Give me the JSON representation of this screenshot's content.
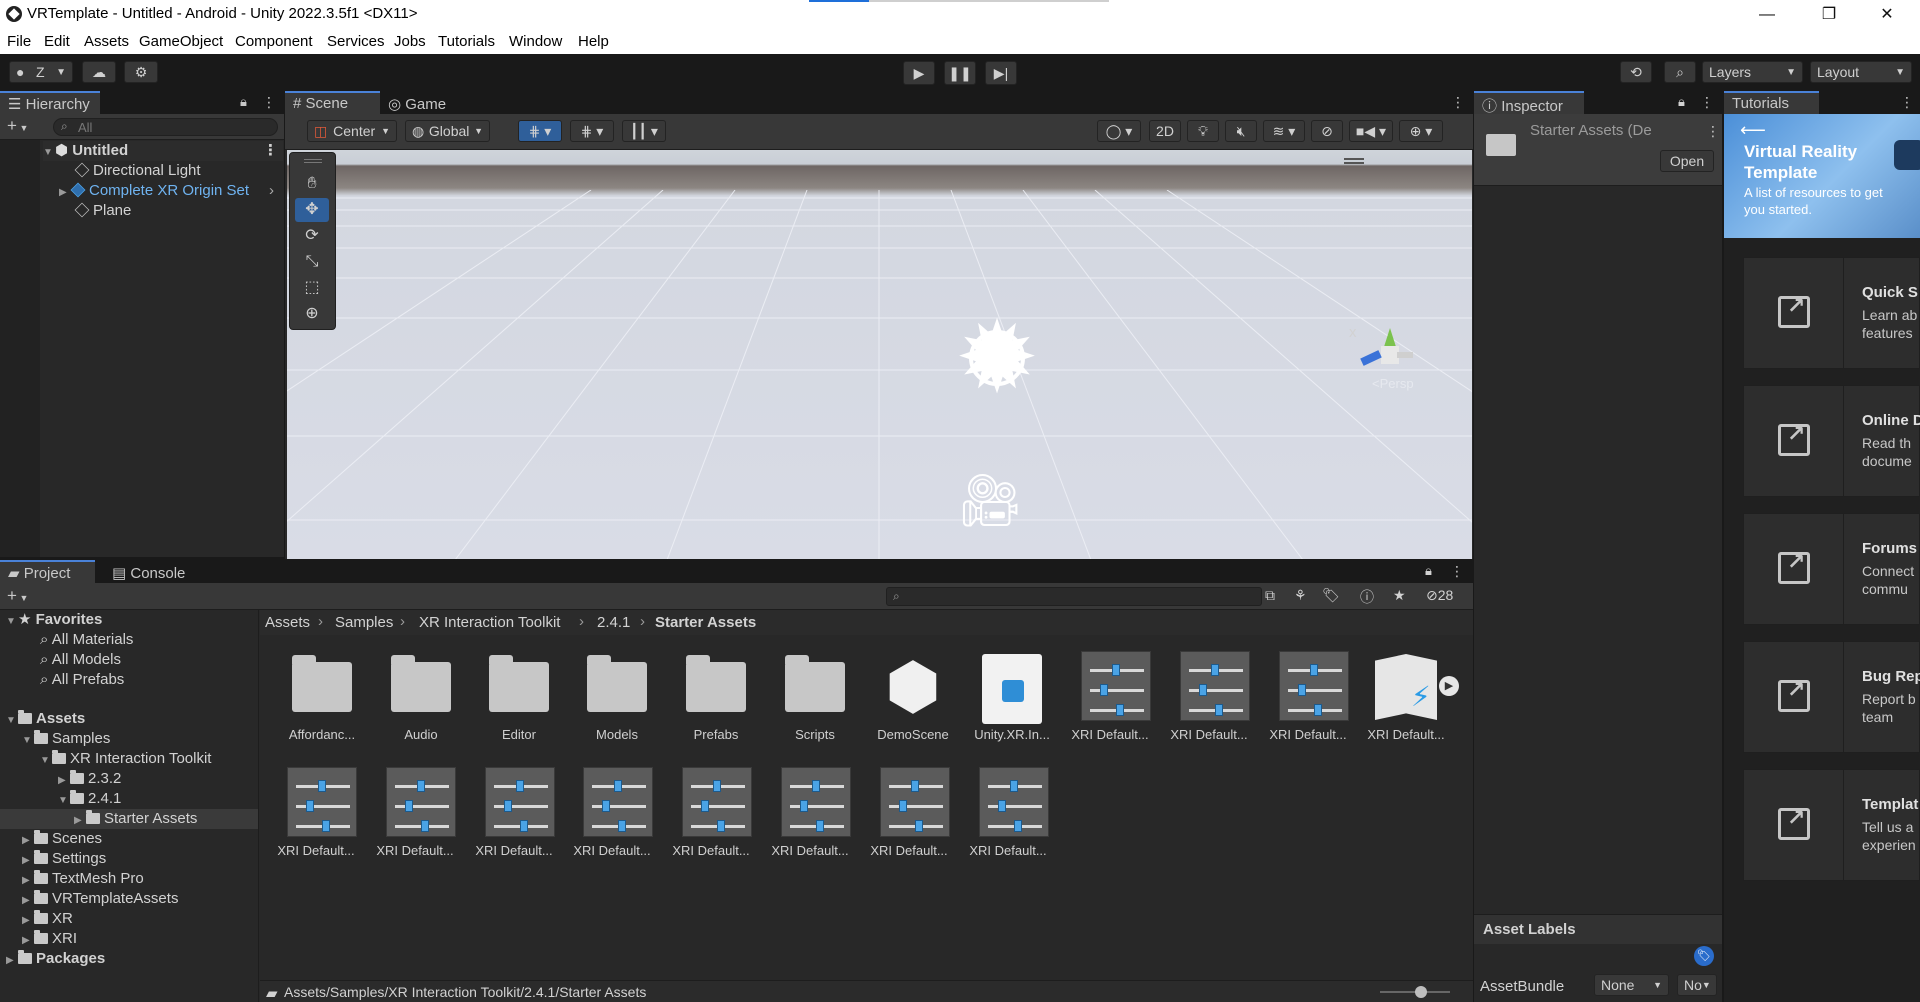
{
  "window": {
    "title": "VRTemplate - Untitled - Android - Unity 2022.3.5f1 <DX11>",
    "minimize": "—",
    "restore": "❐",
    "close": "✕"
  },
  "menu": [
    "File",
    "Edit",
    "Assets",
    "GameObject",
    "Component",
    "Services",
    "Jobs",
    "Tutorials",
    "Window",
    "Help"
  ],
  "toolbar": {
    "account_label": "Z",
    "layers_label": "Layers",
    "layout_label": "Layout"
  },
  "hierarchy": {
    "tab": "Hierarchy",
    "search_placeholder": "All",
    "scene_name": "Untitled",
    "items": [
      "Directional Light",
      "Complete XR Origin Set",
      "Plane"
    ]
  },
  "scene": {
    "tabs": [
      "Scene",
      "Game"
    ],
    "pivot": "Center",
    "space": "Global",
    "mode_2d": "2D",
    "gizmo_axis": "x",
    "persp_label": "<Persp"
  },
  "inspector": {
    "tab": "Inspector",
    "asset_name": "Starter Assets (De",
    "open_button": "Open",
    "asset_labels": "Asset Labels",
    "asset_bundle": "AssetBundle",
    "bundle_value": "None",
    "variant_value": "No"
  },
  "project": {
    "tabs": [
      "Project",
      "Console"
    ],
    "hidden_count": "28",
    "breadcrumb": [
      "Assets",
      "Samples",
      "XR Interaction Toolkit",
      "2.4.1",
      "Starter Assets"
    ],
    "path": "Assets/Samples/XR Interaction Toolkit/2.4.1/Starter Assets",
    "favorites_label": "Favorites",
    "favorites": [
      "All Materials",
      "All Models",
      "All Prefabs"
    ],
    "assets_label": "Assets",
    "tree": [
      "Samples",
      "XR Interaction Toolkit",
      "2.3.2",
      "2.4.1",
      "Starter Assets",
      "Scenes",
      "Settings",
      "TextMesh Pro",
      "VRTemplateAssets",
      "XR",
      "XRI"
    ],
    "packages_label": "Packages",
    "row1": [
      "Affordanc...",
      "Audio",
      "Editor",
      "Models",
      "Prefabs",
      "Scripts",
      "DemoScene",
      "Unity.XR.In...",
      "XRI Default...",
      "XRI Default...",
      "XRI Default...",
      "XRI Default..."
    ],
    "row2": [
      "XRI Default...",
      "XRI Default...",
      "XRI Default...",
      "XRI Default...",
      "XRI Default...",
      "XRI Default...",
      "XRI Default...",
      "XRI Default..."
    ]
  },
  "tutorials": {
    "tab": "Tutorials",
    "banner_title": "Virtual Reality Template",
    "banner_sub": "A list of resources to get you started.",
    "cards": [
      {
        "title": "Quick S",
        "desc": "Learn ab\nfeatures"
      },
      {
        "title": "Online D",
        "desc": "Read th\ndocume"
      },
      {
        "title": "Forums",
        "desc": "Connect\ncommu"
      },
      {
        "title": "Bug Rep",
        "desc": "Report b\nteam"
      },
      {
        "title": "Templat",
        "desc": "Tell us a\nexperien"
      }
    ]
  },
  "colors": {
    "accent": "#4a82d8",
    "panel": "#282828",
    "toolbar": "#191919"
  }
}
